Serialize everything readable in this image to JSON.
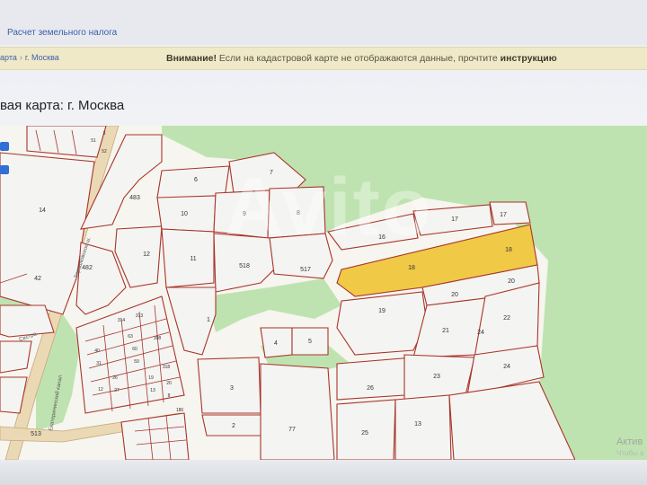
{
  "header": {
    "land_tax_link": "Расчет земельного налога"
  },
  "breadcrumb": {
    "left": "арта",
    "city": "г. Москва"
  },
  "notice": {
    "prefix": "Внимание!",
    "text": " Если на кадастровой карте не отображаются данные, прочтите ",
    "link": "инструкцию"
  },
  "page": {
    "title": "вая карта: г. Москва"
  },
  "map": {
    "streets": {
      "s1": "Тарашковское ш.",
      "s2": "Сестра",
      "s3": "Екатерининский канал"
    },
    "plots": {
      "p1": "1",
      "p2": "2",
      "p3": "3",
      "p4": "4",
      "p5": "5",
      "p6": "6",
      "p7": "7",
      "p8": "8",
      "p9": "9",
      "p10": "10",
      "p11": "11",
      "p12": "12",
      "p13": "13",
      "p14": "14",
      "p16": "16",
      "p17a": "17",
      "p17b": "17",
      "p18": "18",
      "p18b": "18",
      "p19": "19",
      "p20": "20",
      "p20b": "20",
      "p21": "21",
      "p22": "22",
      "p23": "23",
      "p24": "24",
      "p24b": "24",
      "p25": "25",
      "p26": "26",
      "p77": "77",
      "p482": "482",
      "p483": "483",
      "p517": "517",
      "p518": "518",
      "p513": "513",
      "p51": "51",
      "p52": "52",
      "p3b": "3",
      "p314": "314",
      "p313": "313",
      "p308": "308",
      "p318": "318",
      "p186": "186",
      "p42": "42",
      "p40": "40",
      "p31": "31",
      "p63": "63",
      "p60": "60",
      "p59": "59",
      "p26s": "26",
      "p27": "27",
      "p12s": "12",
      "p19s": "19",
      "p13s": "13",
      "p20s": "20",
      "p8s": "8"
    }
  },
  "watermark": "Avito",
  "activation": {
    "title": "Актив",
    "sub": "Чтобы а"
  }
}
